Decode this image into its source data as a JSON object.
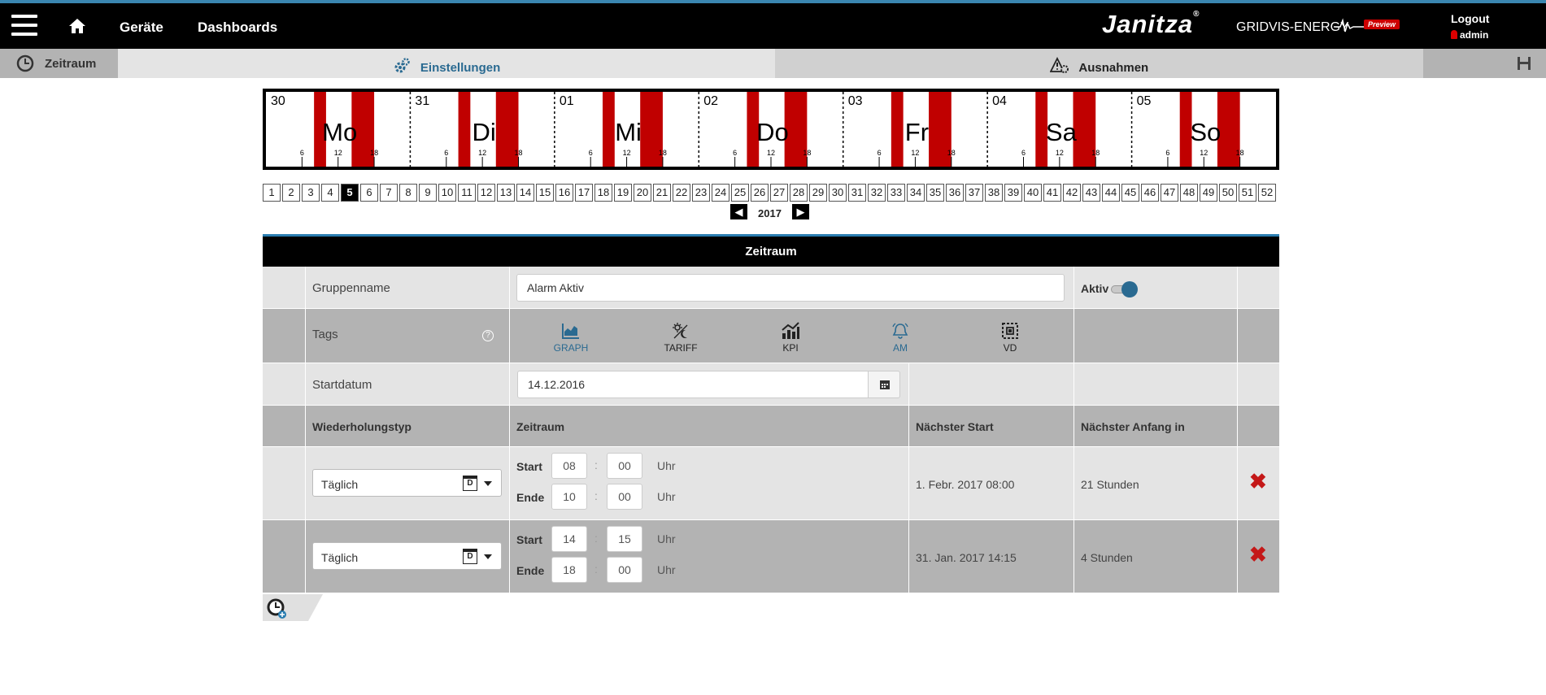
{
  "topbar": {
    "nav": [
      "Geräte",
      "Dashboards"
    ],
    "brand": "Janitza",
    "brand_mark": "®",
    "product": "GRIDVIS-ENERGY",
    "preview": "Preview",
    "logout": "Logout",
    "user": "admin",
    "accent_color": "#3a86b0"
  },
  "tabs": {
    "zeitraum": "Zeitraum",
    "einstellungen": "Einstellungen",
    "ausnahmen": "Ausnahmen"
  },
  "week": {
    "days": [
      {
        "date": "30",
        "name": "Mo"
      },
      {
        "date": "31",
        "name": "Di"
      },
      {
        "date": "01",
        "name": "Mi"
      },
      {
        "date": "02",
        "name": "Do"
      },
      {
        "date": "03",
        "name": "Fr"
      },
      {
        "date": "04",
        "name": "Sa"
      },
      {
        "date": "05",
        "name": "So"
      }
    ],
    "hour_ticks": [
      "6",
      "12",
      "18"
    ],
    "active_intervals": [
      [
        "08:00",
        "10:00"
      ],
      [
        "14:15",
        "18:00"
      ]
    ],
    "bar_color": "#c00000"
  },
  "pager": {
    "weeks": [
      "1",
      "2",
      "3",
      "4",
      "5",
      "6",
      "7",
      "8",
      "9",
      "10",
      "11",
      "12",
      "13",
      "14",
      "15",
      "16",
      "17",
      "18",
      "19",
      "20",
      "21",
      "22",
      "23",
      "24",
      "25",
      "26",
      "27",
      "28",
      "29",
      "30",
      "31",
      "32",
      "33",
      "34",
      "35",
      "36",
      "37",
      "38",
      "39",
      "40",
      "41",
      "42",
      "43",
      "44",
      "45",
      "46",
      "47",
      "48",
      "49",
      "50",
      "51",
      "52"
    ],
    "active": "5",
    "year": "2017",
    "prev": "◀",
    "next": "▶"
  },
  "panel": {
    "title": "Zeitraum",
    "groupname_label": "Gruppenname",
    "groupname_value": "Alarm Aktiv",
    "aktiv_label": "Aktiv",
    "aktiv_on": true,
    "tags_label": "Tags",
    "help": "?",
    "tags": [
      {
        "label": "GRAPH",
        "icon": "graph-icon",
        "color": "#2a6a91"
      },
      {
        "label": "TARIFF",
        "icon": "tariff-icon",
        "color": "#222"
      },
      {
        "label": "KPI",
        "icon": "kpi-icon",
        "color": "#222"
      },
      {
        "label": "AM",
        "icon": "bell-icon",
        "color": "#2a6a91"
      },
      {
        "label": "VD",
        "icon": "vd-icon",
        "color": "#222"
      }
    ],
    "startdatum_label": "Startdatum",
    "startdatum_value": "14.12.2016",
    "columns": [
      "Wiederholungstyp",
      "Zeitraum",
      "Nächster Start",
      "Nächster Anfang in"
    ],
    "start_label": "Start",
    "ende_label": "Ende",
    "uhr_label": "Uhr",
    "colon": ":",
    "schedules": [
      {
        "typ": "Täglich",
        "start_h": "08",
        "start_m": "00",
        "end_h": "10",
        "end_m": "00",
        "next_start": "1. Febr. 2017 08:00",
        "next_in": "21 Stunden"
      },
      {
        "typ": "Täglich",
        "start_h": "14",
        "start_m": "15",
        "end_h": "18",
        "end_m": "00",
        "next_start": "31. Jan. 2017 14:15",
        "next_in": "4 Stunden"
      }
    ],
    "delete": "✖",
    "cal_letter": "D"
  }
}
